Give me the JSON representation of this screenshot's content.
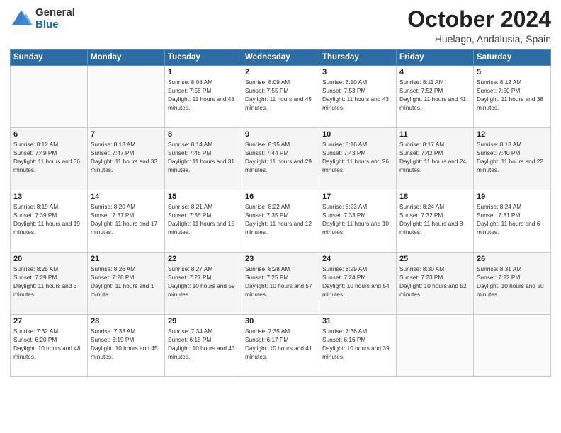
{
  "header": {
    "logo_general": "General",
    "logo_blue": "Blue",
    "month_title": "October 2024",
    "location": "Huelago, Andalusia, Spain"
  },
  "weekdays": [
    "Sunday",
    "Monday",
    "Tuesday",
    "Wednesday",
    "Thursday",
    "Friday",
    "Saturday"
  ],
  "weeks": [
    [
      {
        "day": "",
        "info": ""
      },
      {
        "day": "",
        "info": ""
      },
      {
        "day": "1",
        "info": "Sunrise: 8:08 AM\nSunset: 7:56 PM\nDaylight: 11 hours and 48 minutes."
      },
      {
        "day": "2",
        "info": "Sunrise: 8:09 AM\nSunset: 7:55 PM\nDaylight: 11 hours and 45 minutes."
      },
      {
        "day": "3",
        "info": "Sunrise: 8:10 AM\nSunset: 7:53 PM\nDaylight: 11 hours and 43 minutes."
      },
      {
        "day": "4",
        "info": "Sunrise: 8:11 AM\nSunset: 7:52 PM\nDaylight: 11 hours and 41 minutes."
      },
      {
        "day": "5",
        "info": "Sunrise: 8:12 AM\nSunset: 7:50 PM\nDaylight: 11 hours and 38 minutes."
      }
    ],
    [
      {
        "day": "6",
        "info": "Sunrise: 8:12 AM\nSunset: 7:49 PM\nDaylight: 11 hours and 36 minutes."
      },
      {
        "day": "7",
        "info": "Sunrise: 8:13 AM\nSunset: 7:47 PM\nDaylight: 11 hours and 33 minutes."
      },
      {
        "day": "8",
        "info": "Sunrise: 8:14 AM\nSunset: 7:46 PM\nDaylight: 11 hours and 31 minutes."
      },
      {
        "day": "9",
        "info": "Sunrise: 8:15 AM\nSunset: 7:44 PM\nDaylight: 11 hours and 29 minutes."
      },
      {
        "day": "10",
        "info": "Sunrise: 8:16 AM\nSunset: 7:43 PM\nDaylight: 11 hours and 26 minutes."
      },
      {
        "day": "11",
        "info": "Sunrise: 8:17 AM\nSunset: 7:42 PM\nDaylight: 11 hours and 24 minutes."
      },
      {
        "day": "12",
        "info": "Sunrise: 8:18 AM\nSunset: 7:40 PM\nDaylight: 11 hours and 22 minutes."
      }
    ],
    [
      {
        "day": "13",
        "info": "Sunrise: 8:19 AM\nSunset: 7:39 PM\nDaylight: 11 hours and 19 minutes."
      },
      {
        "day": "14",
        "info": "Sunrise: 8:20 AM\nSunset: 7:37 PM\nDaylight: 11 hours and 17 minutes."
      },
      {
        "day": "15",
        "info": "Sunrise: 8:21 AM\nSunset: 7:36 PM\nDaylight: 11 hours and 15 minutes."
      },
      {
        "day": "16",
        "info": "Sunrise: 8:22 AM\nSunset: 7:35 PM\nDaylight: 11 hours and 12 minutes."
      },
      {
        "day": "17",
        "info": "Sunrise: 8:23 AM\nSunset: 7:33 PM\nDaylight: 11 hours and 10 minutes."
      },
      {
        "day": "18",
        "info": "Sunrise: 8:24 AM\nSunset: 7:32 PM\nDaylight: 11 hours and 8 minutes."
      },
      {
        "day": "19",
        "info": "Sunrise: 8:24 AM\nSunset: 7:31 PM\nDaylight: 11 hours and 6 minutes."
      }
    ],
    [
      {
        "day": "20",
        "info": "Sunrise: 8:25 AM\nSunset: 7:29 PM\nDaylight: 11 hours and 3 minutes."
      },
      {
        "day": "21",
        "info": "Sunrise: 8:26 AM\nSunset: 7:28 PM\nDaylight: 11 hours and 1 minute."
      },
      {
        "day": "22",
        "info": "Sunrise: 8:27 AM\nSunset: 7:27 PM\nDaylight: 10 hours and 59 minutes."
      },
      {
        "day": "23",
        "info": "Sunrise: 8:28 AM\nSunset: 7:25 PM\nDaylight: 10 hours and 57 minutes."
      },
      {
        "day": "24",
        "info": "Sunrise: 8:29 AM\nSunset: 7:24 PM\nDaylight: 10 hours and 54 minutes."
      },
      {
        "day": "25",
        "info": "Sunrise: 8:30 AM\nSunset: 7:23 PM\nDaylight: 10 hours and 52 minutes."
      },
      {
        "day": "26",
        "info": "Sunrise: 8:31 AM\nSunset: 7:22 PM\nDaylight: 10 hours and 50 minutes."
      }
    ],
    [
      {
        "day": "27",
        "info": "Sunrise: 7:32 AM\nSunset: 6:20 PM\nDaylight: 10 hours and 48 minutes."
      },
      {
        "day": "28",
        "info": "Sunrise: 7:33 AM\nSunset: 6:19 PM\nDaylight: 10 hours and 45 minutes."
      },
      {
        "day": "29",
        "info": "Sunrise: 7:34 AM\nSunset: 6:18 PM\nDaylight: 10 hours and 43 minutes."
      },
      {
        "day": "30",
        "info": "Sunrise: 7:35 AM\nSunset: 6:17 PM\nDaylight: 10 hours and 41 minutes."
      },
      {
        "day": "31",
        "info": "Sunrise: 7:36 AM\nSunset: 6:16 PM\nDaylight: 10 hours and 39 minutes."
      },
      {
        "day": "",
        "info": ""
      },
      {
        "day": "",
        "info": ""
      }
    ]
  ]
}
